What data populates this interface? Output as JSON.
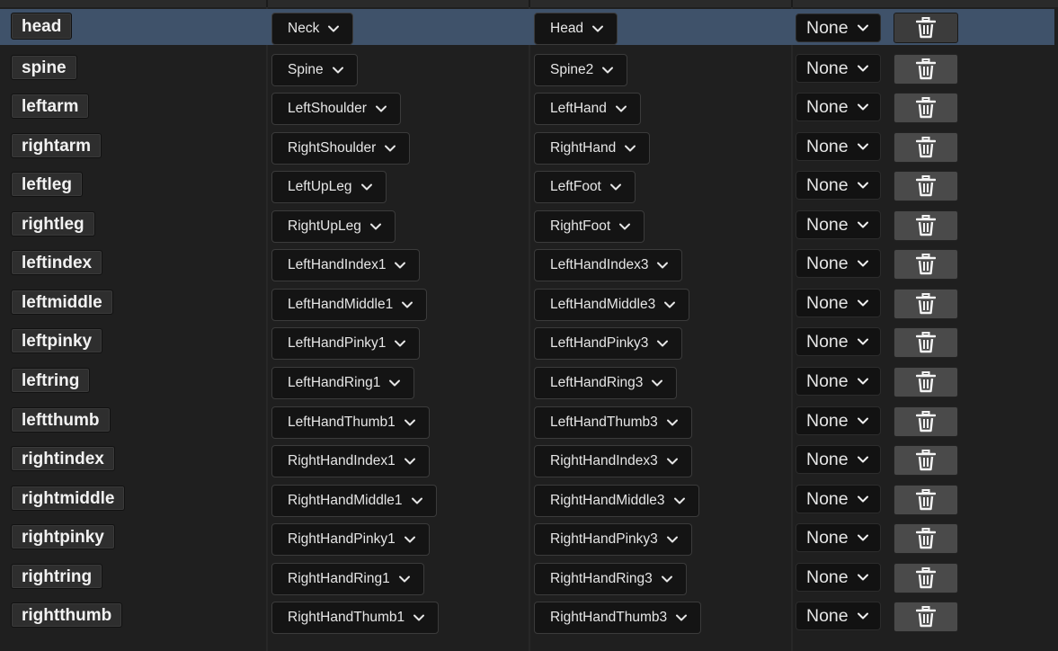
{
  "rows": [
    {
      "name": "head",
      "source": "Neck",
      "target": "Head",
      "axis": "None",
      "selected": true
    },
    {
      "name": "spine",
      "source": "Spine",
      "target": "Spine2",
      "axis": "None"
    },
    {
      "name": "leftarm",
      "source": "LeftShoulder",
      "target": "LeftHand",
      "axis": "None"
    },
    {
      "name": "rightarm",
      "source": "RightShoulder",
      "target": "RightHand",
      "axis": "None"
    },
    {
      "name": "leftleg",
      "source": "LeftUpLeg",
      "target": "LeftFoot",
      "axis": "None"
    },
    {
      "name": "rightleg",
      "source": "RightUpLeg",
      "target": "RightFoot",
      "axis": "None"
    },
    {
      "name": "leftindex",
      "source": "LeftHandIndex1",
      "target": "LeftHandIndex3",
      "axis": "None"
    },
    {
      "name": "leftmiddle",
      "source": "LeftHandMiddle1",
      "target": "LeftHandMiddle3",
      "axis": "None"
    },
    {
      "name": "leftpinky",
      "source": "LeftHandPinky1",
      "target": "LeftHandPinky3",
      "axis": "None"
    },
    {
      "name": "leftring",
      "source": "LeftHandRing1",
      "target": "LeftHandRing3",
      "axis": "None"
    },
    {
      "name": "leftthumb",
      "source": "LeftHandThumb1",
      "target": "LeftHandThumb3",
      "axis": "None"
    },
    {
      "name": "rightindex",
      "source": "RightHandIndex1",
      "target": "RightHandIndex3",
      "axis": "None"
    },
    {
      "name": "rightmiddle",
      "source": "RightHandMiddle1",
      "target": "RightHandMiddle3",
      "axis": "None"
    },
    {
      "name": "rightpinky",
      "source": "RightHandPinky1",
      "target": "RightHandPinky3",
      "axis": "None"
    },
    {
      "name": "rightring",
      "source": "RightHandRing1",
      "target": "RightHandRing3",
      "axis": "None"
    },
    {
      "name": "rightthumb",
      "source": "RightHandThumb1",
      "target": "RightHandThumb3",
      "axis": "None"
    }
  ],
  "icons": {
    "dropdown": "chevron-down-icon",
    "delete": "trash-icon"
  },
  "colors": {
    "selected_row": "#3f526a",
    "background": "#1f1f1f",
    "dropdown_bg": "#141414",
    "delete_button": "#4a4a4a"
  }
}
